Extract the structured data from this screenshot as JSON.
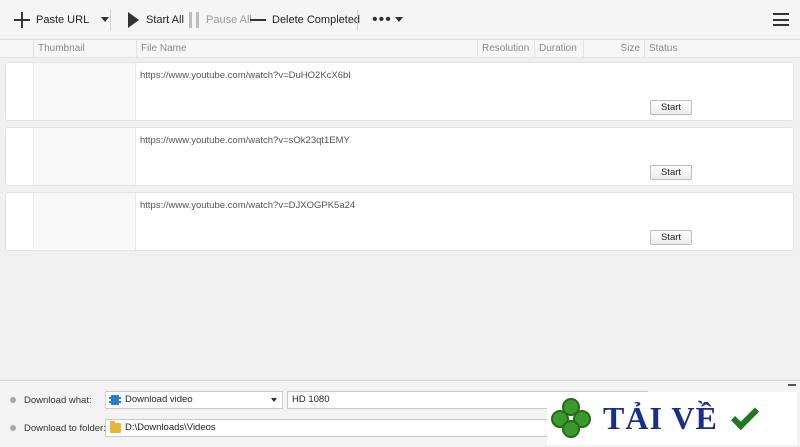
{
  "toolbar": {
    "paste_url": "Paste URL",
    "start_all": "Start All",
    "pause_all": "Pause All",
    "delete_completed": "Delete Completed",
    "more": "•••"
  },
  "columns": {
    "thumbnail": "Thumbnail",
    "file_name": "File Name",
    "resolution": "Resolution",
    "duration": "Duration",
    "size": "Size",
    "status": "Status"
  },
  "downloads": [
    {
      "url": "https://www.youtube.com/watch?v=DuHO2KcX6bI",
      "button": "Start"
    },
    {
      "url": "https://www.youtube.com/watch?v=sOk23qt1EMY",
      "button": "Start"
    },
    {
      "url": "https://www.youtube.com/watch?v=DJXOGPK5a24",
      "button": "Start"
    }
  ],
  "bottom": {
    "download_what_label": "Download what:",
    "download_what_value": "Download video",
    "quality_value": "HD 1080",
    "download_to_label": "Download to folder:",
    "folder_value": "D:\\Downloads\\Videos"
  },
  "watermark": {
    "text": "TẢI VỀ"
  }
}
